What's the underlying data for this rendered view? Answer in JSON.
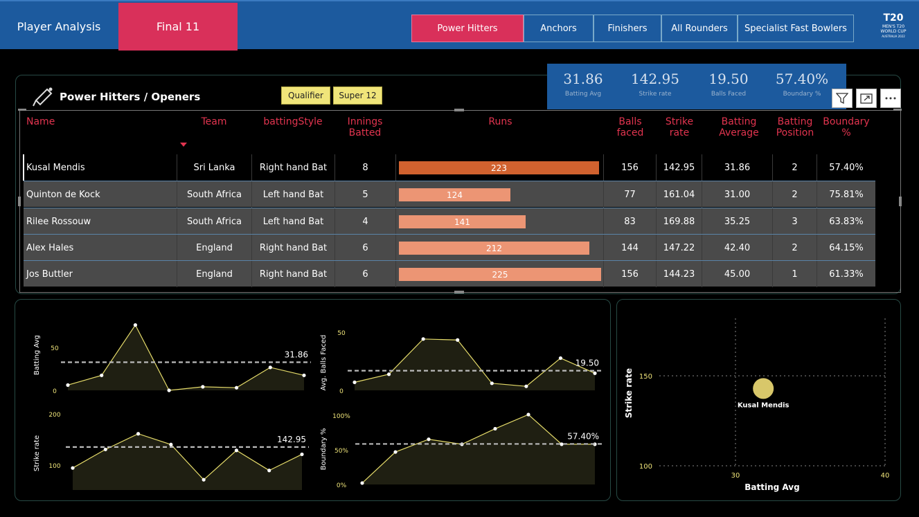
{
  "header": {
    "player_analysis": "Player Analysis",
    "final11": "Final 11",
    "nav": [
      "Power Hitters",
      "Anchors",
      "Finishers",
      "All Rounders",
      "Specialist Fast Bowlers"
    ],
    "active_nav": "Power Hitters",
    "logo_text": "MEN'S T20 WORLD CUP AUSTRALIA 2022"
  },
  "kpis": [
    {
      "value": "31.86",
      "label": "Batting Avg"
    },
    {
      "value": "142.95",
      "label": "Strike rate"
    },
    {
      "value": "19.50",
      "label": "Balls Faced"
    },
    {
      "value": "57.40%",
      "label": "Boundary %"
    }
  ],
  "panel_title": "Power Hitters / Openers",
  "slicers": [
    "Qualifier",
    "Super 12"
  ],
  "colors": {
    "accent": "#d9305a",
    "header": "#1c5a9e",
    "bar_first": "#d1622f",
    "bar": "#ec9574",
    "line": "#e6dc6a",
    "bubble": "#d8c76a"
  },
  "table": {
    "headers": [
      "Name",
      "Team",
      "battingStyle",
      "Innings Batted",
      "Runs",
      "Balls faced",
      "Strike rate",
      "Batting Average",
      "Batting Position",
      "Boundary %"
    ],
    "rows": [
      {
        "name": "Kusal Mendis",
        "team": "Sri Lanka",
        "style": "Right hand Bat",
        "innings": "8",
        "runs": 223,
        "balls": "156",
        "sr": "142.95",
        "avg": "31.86",
        "pos": "2",
        "boundary": "57.40%"
      },
      {
        "name": "Quinton de Kock",
        "team": "South Africa",
        "style": "Left hand Bat",
        "innings": "5",
        "runs": 124,
        "balls": "77",
        "sr": "161.04",
        "avg": "31.00",
        "pos": "2",
        "boundary": "75.81%"
      },
      {
        "name": "Rilee Rossouw",
        "team": "South Africa",
        "style": "Left hand Bat",
        "innings": "4",
        "runs": 141,
        "balls": "83",
        "sr": "169.88",
        "avg": "35.25",
        "pos": "3",
        "boundary": "63.83%"
      },
      {
        "name": "Alex Hales",
        "team": "England",
        "style": "Right hand Bat",
        "innings": "6",
        "runs": 212,
        "balls": "144",
        "sr": "147.22",
        "avg": "42.40",
        "pos": "2",
        "boundary": "64.15%"
      },
      {
        "name": "Jos Buttler",
        "team": "England",
        "style": "Right hand Bat",
        "innings": "6",
        "runs": 225,
        "balls": "156",
        "sr": "144.23",
        "avg": "45.00",
        "pos": "1",
        "boundary": "61.33%"
      }
    ],
    "runs_max": 225
  },
  "chart_data": [
    {
      "type": "area",
      "ylabel": "Batting Avg",
      "yticks": [
        "50",
        "0"
      ],
      "ylim": [
        0,
        80
      ],
      "values": [
        6,
        17,
        74,
        0,
        4,
        3,
        26,
        17
      ],
      "avg": 31.86,
      "avg_label": "31.86"
    },
    {
      "type": "area",
      "ylabel": "Avg. Balls Faced",
      "yticks": [
        "50",
        "0"
      ],
      "ylim": [
        0,
        55
      ],
      "values": [
        8,
        16,
        51,
        50,
        7,
        4,
        32,
        17
      ],
      "avg": 19.5,
      "avg_label": "19.50"
    },
    {
      "type": "area",
      "ylabel": "Strike rate",
      "yticks": [
        "200",
        "100"
      ],
      "ylim": [
        55,
        205
      ],
      "values": [
        100,
        138,
        170,
        148,
        76,
        136,
        95,
        128
      ],
      "avg": 142.95,
      "avg_label": "142.95"
    },
    {
      "type": "area",
      "ylabel": "Boundary %",
      "yticks": [
        "100%",
        "50%",
        "0%"
      ],
      "ylim": [
        0,
        100
      ],
      "values": [
        2,
        46,
        64,
        57,
        79,
        99,
        57,
        57
      ],
      "avg": 57.4,
      "avg_label": "57.40%"
    },
    {
      "type": "scatter",
      "xlabel": "Batting Avg",
      "ylabel": "Strike rate",
      "xticks": [
        "30",
        "40"
      ],
      "yticks": [
        "150",
        "100"
      ],
      "xlim": [
        30,
        40
      ],
      "ylim": [
        100,
        150
      ],
      "points": [
        {
          "label": "Kusal Mendis",
          "x": 31.86,
          "y": 142.95
        }
      ]
    }
  ]
}
